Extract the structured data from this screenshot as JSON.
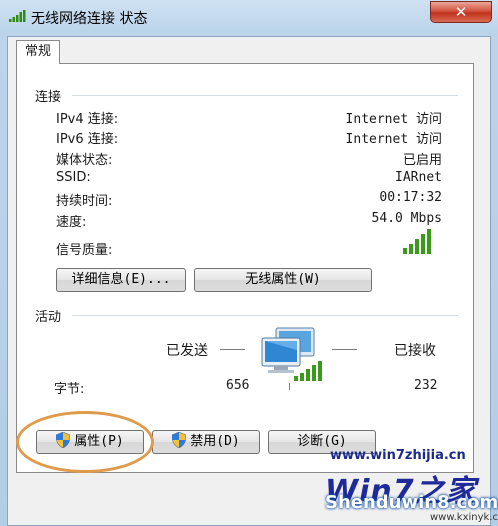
{
  "window": {
    "title": "无线网络连接 状态",
    "close_label": "✕"
  },
  "tabs": [
    "常规"
  ],
  "connection": {
    "heading": "连接",
    "rows": [
      {
        "label": "IPv4 连接:",
        "value": "Internet 访问"
      },
      {
        "label": "IPv6 连接:",
        "value": "Internet 访问"
      },
      {
        "label": "媒体状态:",
        "value": "已启用"
      },
      {
        "label": "SSID:",
        "value": "IARnet"
      },
      {
        "label": "持续时间:",
        "value": "00:17:32"
      },
      {
        "label": "速度:",
        "value": "54.0 Mbps"
      }
    ],
    "signal_label": "信号质量:",
    "signal_bars_lit": 5,
    "signal_bars_total": 5,
    "details_button": "详细信息(E)...",
    "wireless_props_button": "无线属性(W)"
  },
  "activity": {
    "heading": "活动",
    "sent_label": "已发送",
    "received_label": "已接收",
    "bytes_label": "字节:",
    "bytes_sent": "656",
    "bytes_received": "232"
  },
  "buttons": {
    "properties": "属性(P)",
    "disable": "禁用(D)",
    "diagnose": "诊断(G)"
  },
  "watermark": {
    "line1": "www.win7zhijia.cn",
    "line2": "Win7之家",
    "line3": "Shenduwin8.com",
    "line4": "www.kxinyk.com"
  },
  "colors": {
    "highlight": "#e09a4c",
    "signal": "#3a9a1a",
    "close": "#c1321d"
  }
}
